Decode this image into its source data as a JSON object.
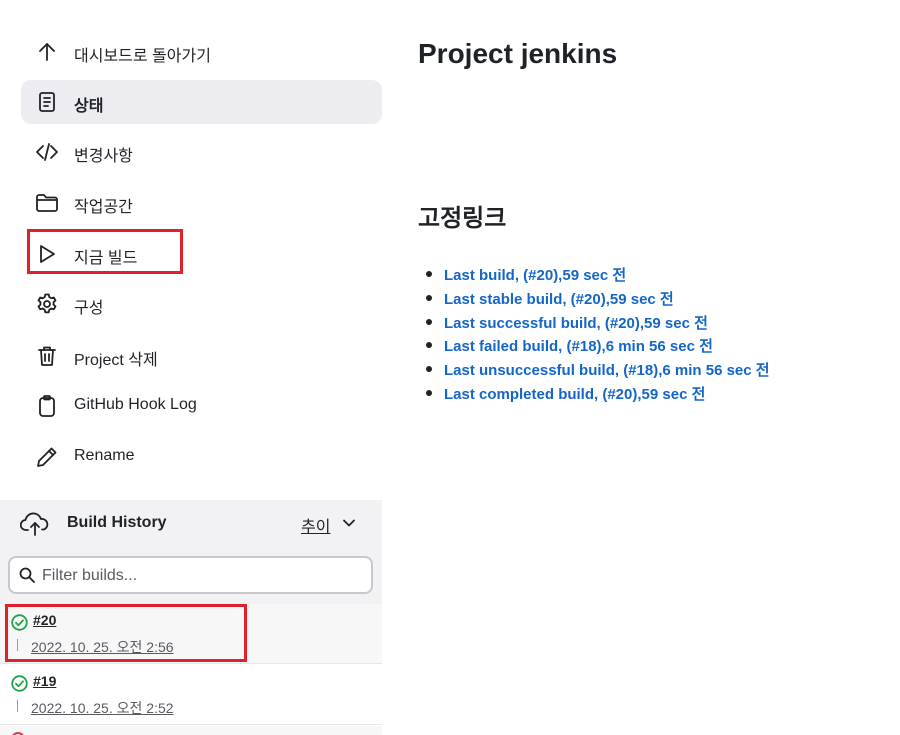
{
  "sidebar": {
    "tasks": [
      {
        "label": "대시보드로 돌아가기",
        "icon": "arrow-up-icon"
      },
      {
        "label": "상태",
        "icon": "document-icon",
        "active": true
      },
      {
        "label": "변경사항",
        "icon": "code-icon"
      },
      {
        "label": "작업공간",
        "icon": "folder-icon"
      },
      {
        "label": "지금 빌드",
        "icon": "play-icon",
        "highlighted": true
      },
      {
        "label": "구성",
        "icon": "gear-icon"
      },
      {
        "label": "Project 삭제",
        "icon": "trash-icon"
      },
      {
        "label": "GitHub Hook Log",
        "icon": "clipboard-icon"
      },
      {
        "label": "Rename",
        "icon": "pencil-icon"
      }
    ]
  },
  "build_history": {
    "title": "Build History",
    "trend_label": "추이",
    "filter": {
      "placeholder": "Filter builds...",
      "value": ""
    },
    "builds": [
      {
        "number": "#20",
        "date": "2022. 10. 25. 오전 2:56",
        "status": "success",
        "highlighted": true
      },
      {
        "number": "#19",
        "date": "2022. 10. 25. 오전 2:52",
        "status": "success"
      }
    ]
  },
  "main": {
    "title": "Project jenkins",
    "permalinks_title": "고정링크",
    "permalinks": [
      "Last build, (#20),59 sec 전",
      "Last stable build, (#20),59 sec 전",
      "Last successful build, (#20),59 sec 전",
      "Last failed build, (#18),6 min 56 sec 전",
      "Last unsuccessful build, (#18),6 min 56 sec 전",
      "Last completed build, (#20),59 sec 전"
    ]
  },
  "colors": {
    "link": "#1466c8",
    "highlight": "#e0202a",
    "success": "#1ea446",
    "active_bg": "#ededf1"
  }
}
